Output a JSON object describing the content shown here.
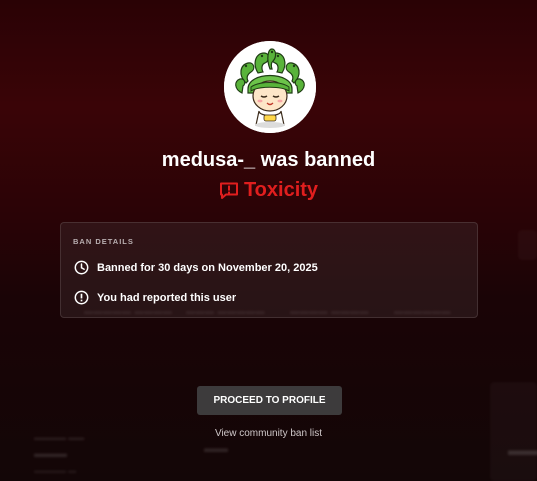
{
  "banned_user": {
    "username": "medusa-_",
    "title": "medusa-_ was banned",
    "reason": "Toxicity",
    "avatar_icon": "medusa-avatar"
  },
  "ban_details": {
    "heading": "BAN DETAILS",
    "items": [
      {
        "icon": "clock-icon",
        "text": "Banned for 30 days on November 20, 2025"
      },
      {
        "icon": "alert-circle-icon",
        "text": "You had reported this user"
      }
    ]
  },
  "actions": {
    "proceed_label": "PROCEED TO PROFILE",
    "ban_list_label": "View community ban list"
  },
  "colors": {
    "accent_red": "#e01e1e",
    "background_top": "#3a0407",
    "button_bg": "#3d3b3c"
  }
}
